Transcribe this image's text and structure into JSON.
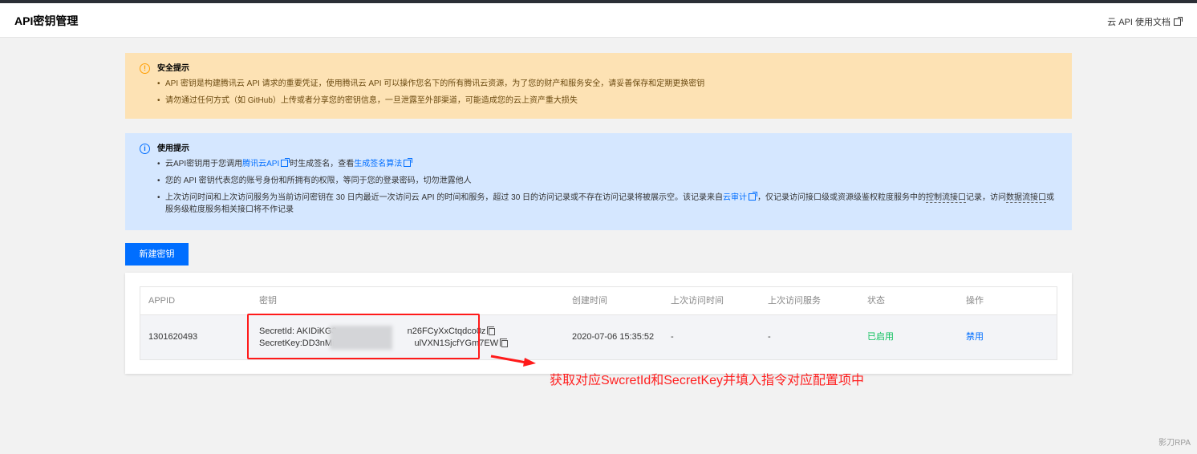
{
  "header": {
    "title": "API密钥管理",
    "doc_link": "云 API 使用文档"
  },
  "security_notice": {
    "title": "安全提示",
    "items": [
      "API 密钥是构建腾讯云 API 请求的重要凭证，使用腾讯云 API 可以操作您名下的所有腾讯云资源，为了您的财产和服务安全，请妥善保存和定期更换密钥",
      "请勿通过任何方式（如 GitHub）上传或者分享您的密钥信息，一旦泄露至外部渠道，可能造成您的云上资产重大损失"
    ]
  },
  "usage_notice": {
    "title": "使用提示",
    "item1_prefix": "云API密钥用于您调用",
    "item1_link1": "腾讯云API",
    "item1_middle": "时生成签名，查看",
    "item1_link2": "生成签名算法",
    "item2": "您的 API 密钥代表您的账号身份和所拥有的权限，等同于您的登录密码，切勿泄露他人",
    "item3_prefix": "上次访问时间和上次访问服务为当前访问密钥在 30 日内最近一次访问云 API 的时间和服务，超过 30 日的访问记录或不存在访问记录将被展示空。该记录来自",
    "item3_link": "云审计",
    "item3_middle": "，仅记录访问接口级或资源级鉴权粒度服务中的",
    "item3_dotted1": "控制流接口",
    "item3_after1": "记录，访问",
    "item3_dotted2": "数据流接口",
    "item3_suffix": "或服务级粒度服务相关接口将不作记录"
  },
  "create_button": "新建密钥",
  "table": {
    "columns": [
      "APPID",
      "密钥",
      "创建时间",
      "上次访问时间",
      "上次访问服务",
      "状态",
      "操作"
    ],
    "rows": [
      {
        "appid": "1301620493",
        "secret_id": "SecretId: AKIDiKG3",
        "secret_id_tail": "n26FCyXxCtqdco0z",
        "secret_key": "SecretKey:DD3nMi",
        "secret_key_tail": "ulVXN1SjcfYGm7EW",
        "created": "2020-07-06 15:35:52",
        "last_access_time": "-",
        "last_access_service": "-",
        "status": "已启用",
        "action": "禁用"
      }
    ]
  },
  "annotation": "获取对应SwcretId和SecretKey并填入指令对应配置项中",
  "watermark": "影刀RPA",
  "colors": {
    "primary": "#006eff",
    "warn_bg": "#fde2b4",
    "info_bg": "#d5e7ff",
    "annotation": "#ff2020",
    "status_on": "#0abf5b"
  }
}
